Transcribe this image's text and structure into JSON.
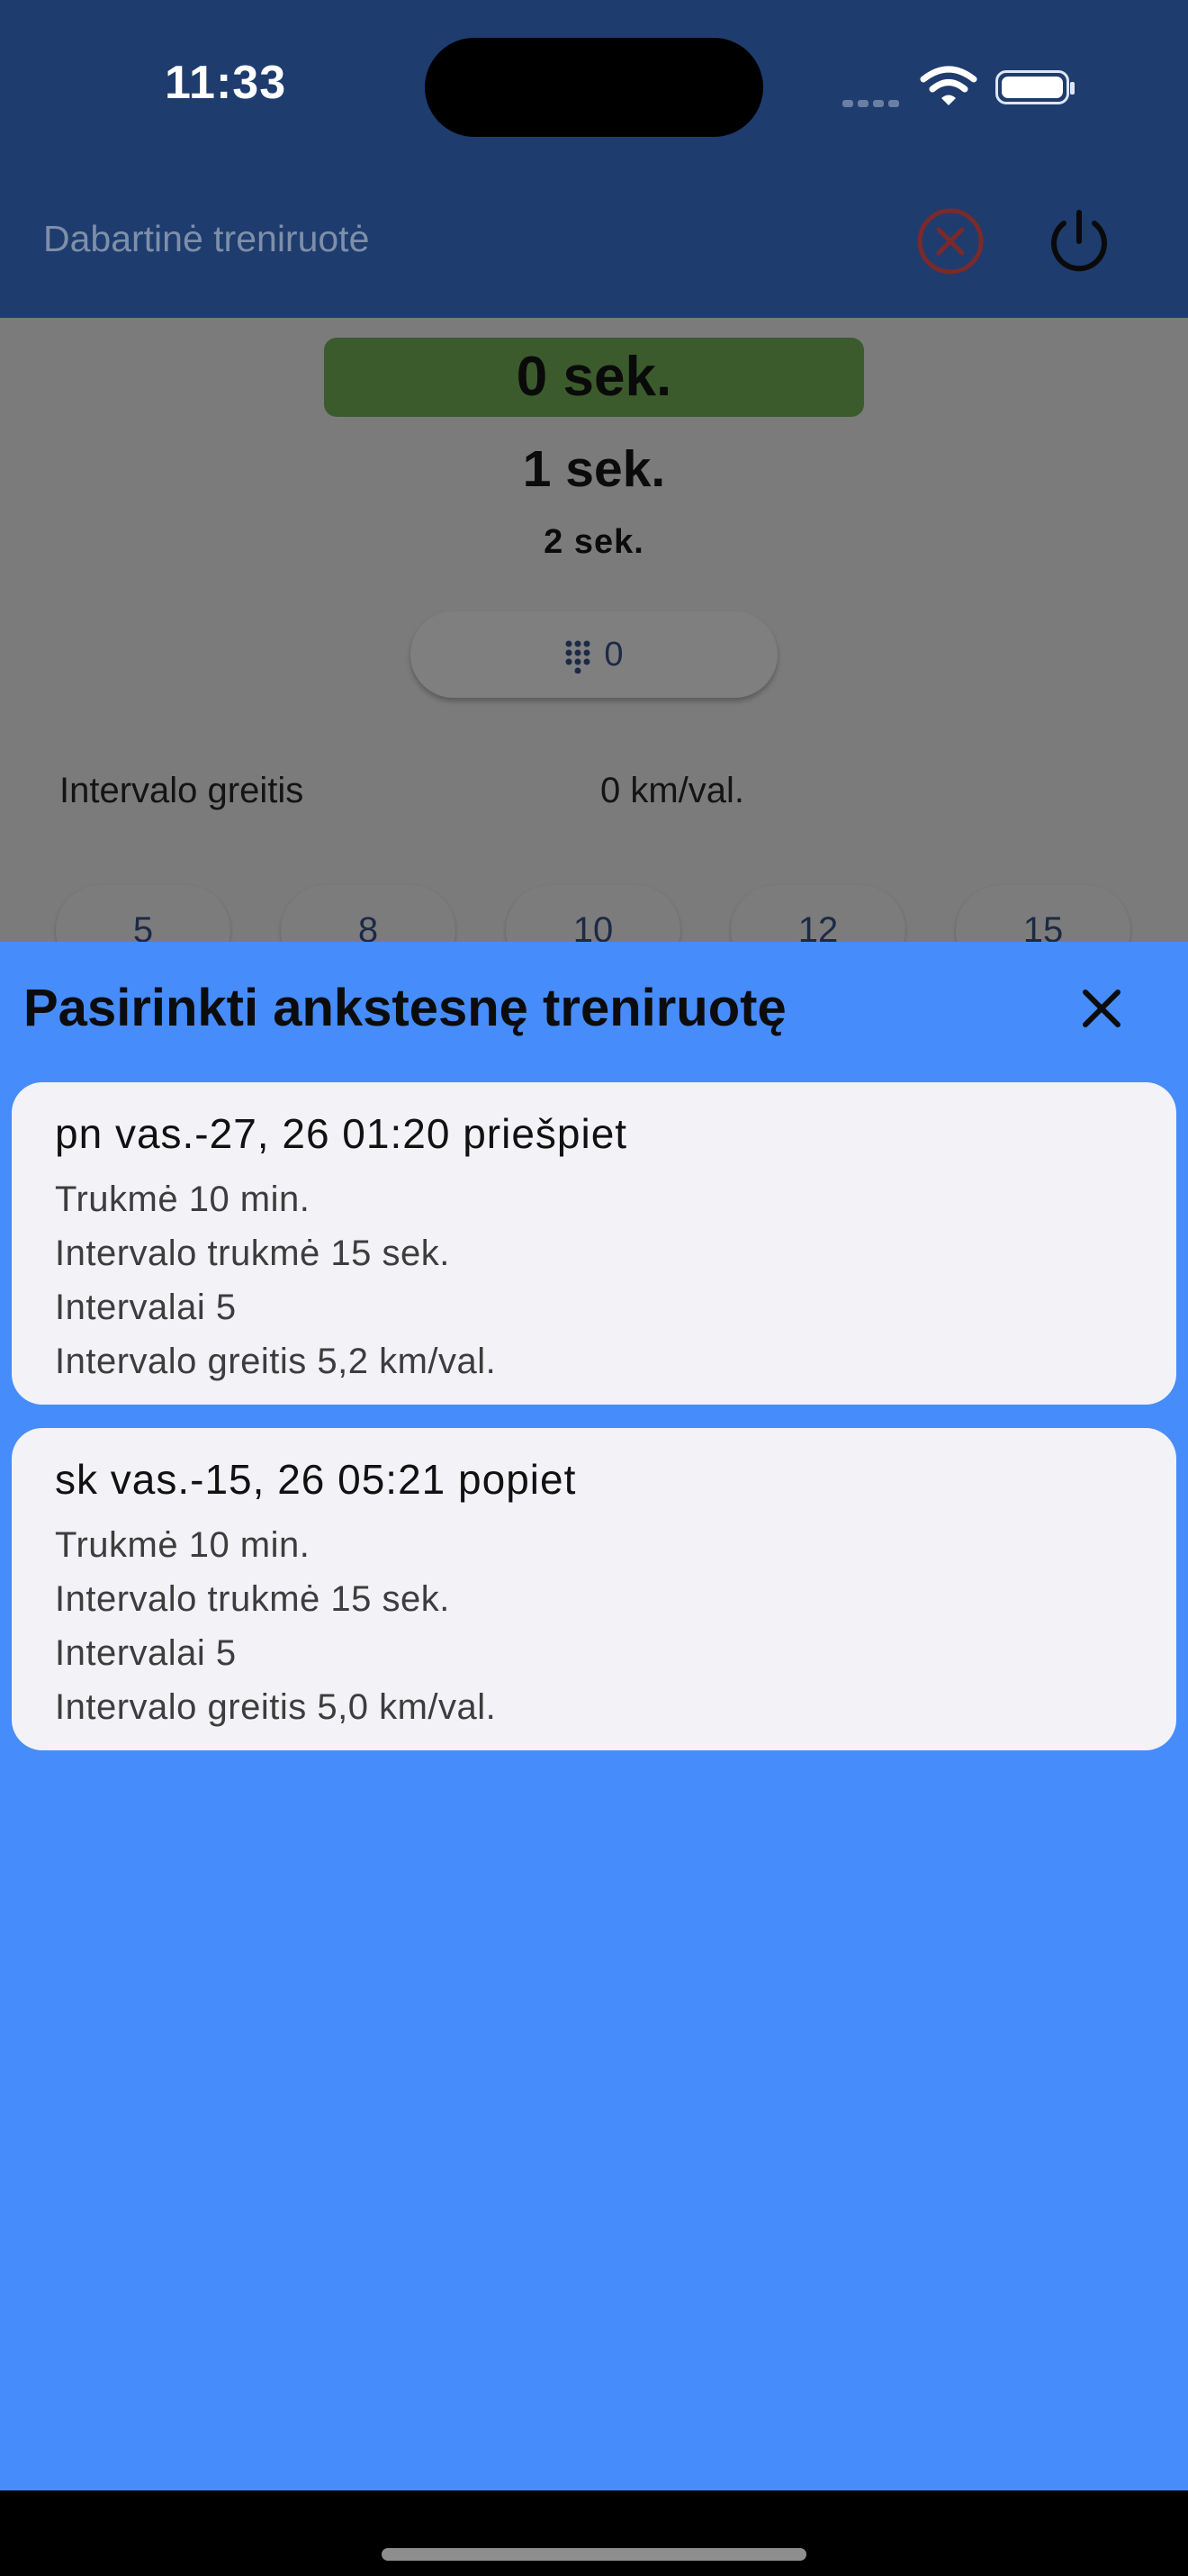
{
  "status_bar": {
    "time": "11:33"
  },
  "app_bar": {
    "title": "Dabartinė treniruotė",
    "cancel_icon": "cancel-circle-icon",
    "power_icon": "power-icon"
  },
  "timer": {
    "current": "0 sek.",
    "next": "1 sek.",
    "after_next": "2 sek."
  },
  "counter": {
    "icon": "dialpad-icon",
    "value": "0"
  },
  "speed": {
    "label": "Intervalo greitis",
    "value": "0 km/val."
  },
  "speed_presets": [
    "5",
    "8",
    "10",
    "12",
    "15"
  ],
  "sheet": {
    "title": "Pasirinkti ankstesnę treniruotę",
    "close_icon": "close-icon",
    "workouts": [
      {
        "date": "pn vas.-27, 26 01:20 priešpiet",
        "duration": "Trukmė 10 min.",
        "interval_duration": "Intervalo trukmė 15 sek.",
        "intervals": "Intervalai 5",
        "interval_speed": "Intervalo greitis 5,2 km/val."
      },
      {
        "date": "sk vas.-15, 26 05:21 popiet",
        "duration": "Trukmė 10 min.",
        "interval_duration": "Intervalo trukmė 15 sek.",
        "intervals": "Intervalai 5",
        "interval_speed": "Intervalo greitis 5,0 km/val."
      }
    ]
  },
  "colors": {
    "app_bar": "#1e3c6e",
    "sheet": "#468cfa",
    "card": "#f2f2f7",
    "cancel": "#c0392b",
    "timer_bg": "#3b5b2c"
  }
}
